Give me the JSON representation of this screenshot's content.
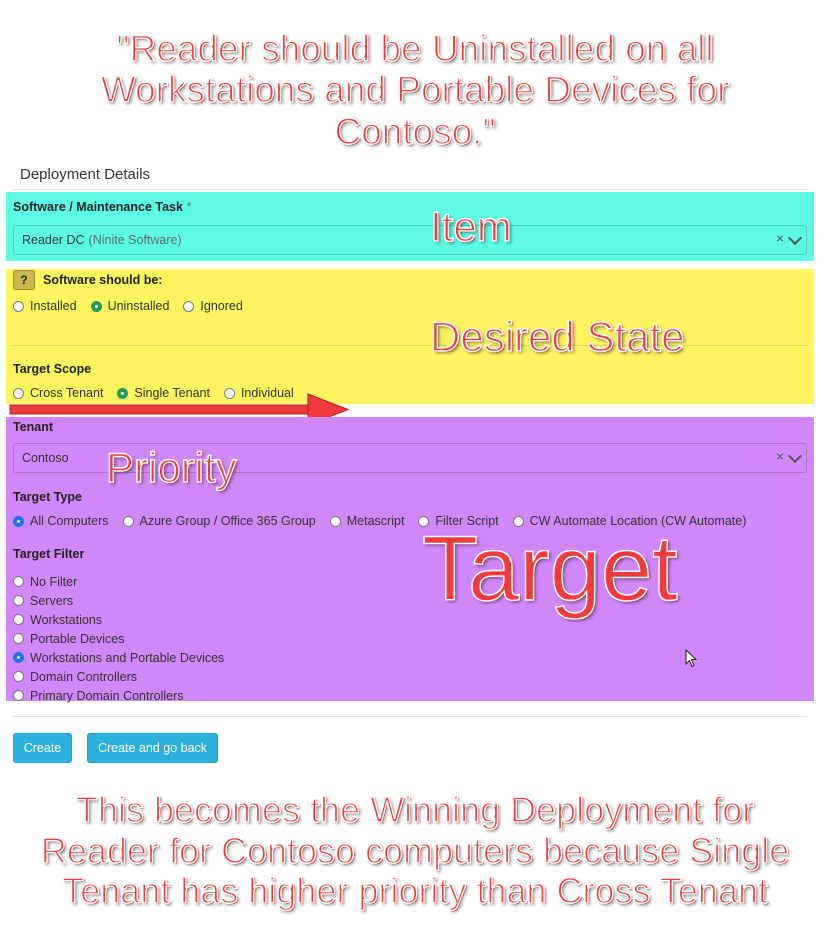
{
  "annotations": {
    "quote_line1": "\"Reader should be Uninstalled on all",
    "quote_line2": "Workstations and Portable Devices for",
    "quote_line3": "Contoso.\"",
    "item": "Item",
    "desired_state": "Desired State",
    "priority": "Priority",
    "target": "Target",
    "bottom_line1": "This becomes the Winning Deployment for",
    "bottom_line2": "Reader for Contoso computers because Single",
    "bottom_line3": "Tenant has higher priority than Cross Tenant"
  },
  "form": {
    "section_title": "Deployment Details",
    "software_label": "Software / Maintenance Task",
    "required_mark": "*",
    "software_value": "Reader DC",
    "software_suffix": "(Ninite Software)",
    "clear_icon": "×",
    "caret_icon": "⌄",
    "help_badge": "?",
    "state_label": "Software should be:",
    "state_options": [
      "Installed",
      "Uninstalled",
      "Ignored"
    ],
    "state_selected": "Uninstalled",
    "scope_label": "Target Scope",
    "scope_options": [
      "Cross Tenant",
      "Single Tenant",
      "Individual"
    ],
    "scope_selected": "Single Tenant",
    "tenant_label": "Tenant",
    "tenant_value": "Contoso",
    "type_label": "Target Type",
    "type_options": [
      "All Computers",
      "Azure Group / Office 365 Group",
      "Metascript",
      "Filter Script",
      "CW Automate Location (CW Automate)"
    ],
    "type_selected": "All Computers",
    "filter_label": "Target Filter",
    "filter_options": [
      "No Filter",
      "Servers",
      "Workstations",
      "Portable Devices",
      "Workstations and Portable Devices",
      "Domain Controllers",
      "Primary Domain Controllers"
    ],
    "filter_selected": "Workstations and Portable Devices",
    "create_button": "Create",
    "create_back_button": "Create and go back"
  },
  "colors": {
    "item_highlight": "#5cfde1",
    "state_highlight": "#fdf460",
    "target_highlight": "#d287f8",
    "annotation_red": "#ef3b3b",
    "button_blue": "#2bb0db"
  }
}
